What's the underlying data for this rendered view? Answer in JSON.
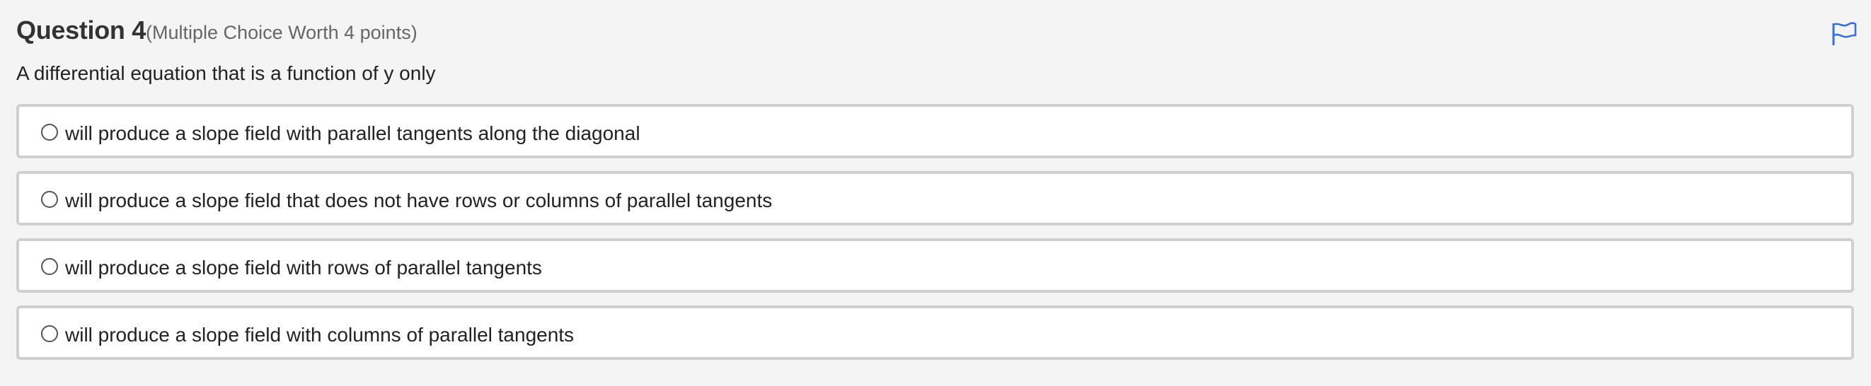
{
  "question": {
    "title": "Question 4",
    "subtitle": "(Multiple Choice Worth 4 points)",
    "prompt": "A differential equation that is a function of y only",
    "flag_icon": "flag-icon",
    "flag_color": "#3a6fd8"
  },
  "choices": [
    {
      "label": "will produce a slope field with parallel tangents along the diagonal",
      "selected": false
    },
    {
      "label": "will produce a slope field that does not have rows or columns of parallel tangents",
      "selected": false
    },
    {
      "label": "will produce a slope field with rows of parallel tangents",
      "selected": false
    },
    {
      "label": "will produce a slope field with columns of parallel tangents",
      "selected": false
    }
  ]
}
